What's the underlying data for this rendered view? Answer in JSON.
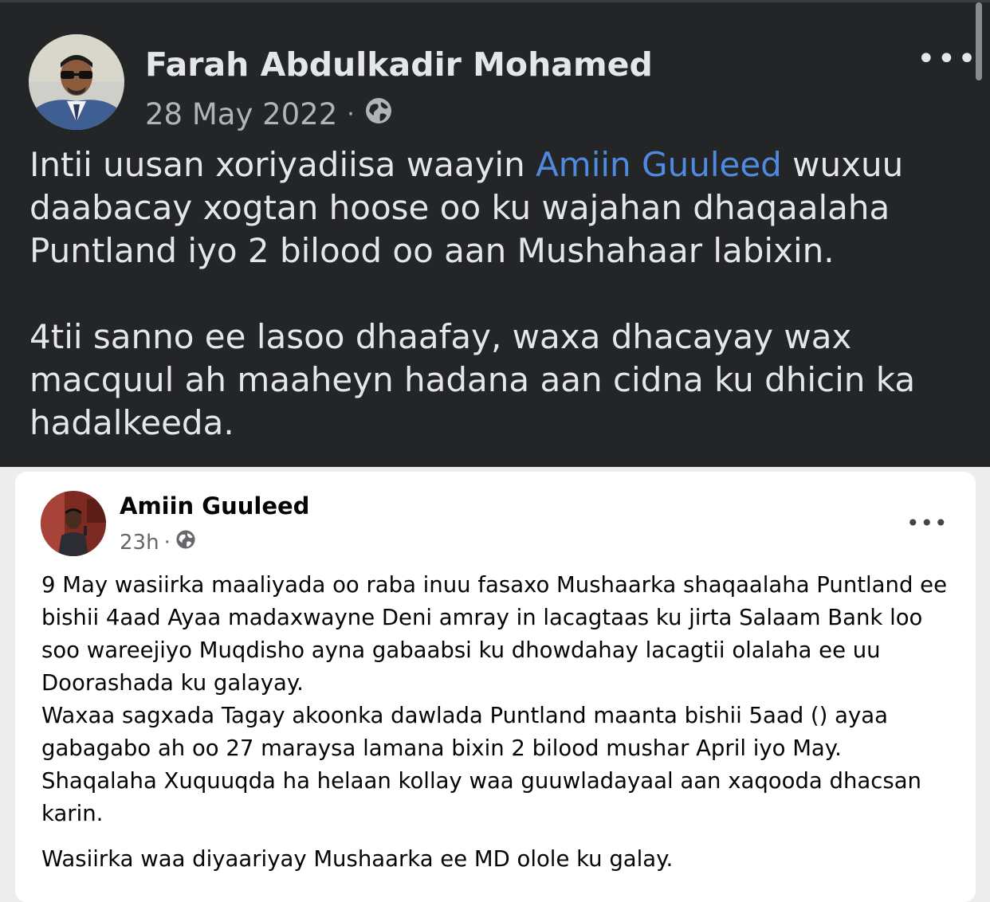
{
  "post": {
    "author": "Farah Abdulkadir Mohamed",
    "date": "28 May 2022",
    "separator": "·",
    "privacy_icon": "globe-icon",
    "menu_icon": "more-options-icon",
    "menu_label": "•••",
    "text": {
      "p1_before": "Intii uusan xoriyadiisa waayin ",
      "p1_mention": "Amiin Guuleed",
      "p1_after": " wuxuu daabacay xogtan hoose oo ku wajahan dhaqaalaha Puntland iyo 2 bilood oo aan Mushahaar labixin.",
      "p2": "4tii sanno ee lasoo dhaafay, waxa dhacayay wax macquul ah maaheyn hadana aan cidna ku dhicin ka hadalkeeda."
    }
  },
  "shared_post": {
    "author": "Amiin Guuleed",
    "time": "23h",
    "separator": "·",
    "privacy_icon": "globe-icon",
    "menu_label": "•••",
    "paragraphs": [
      "9 May wasiirka maaliyada oo raba inuu fasaxo Mushaarka shaqaalaha Puntland ee bishii 4aad Ayaa madaxwayne Deni amray in lacagtaas ku jirta Salaam Bank loo soo wareejiyo Muqdisho ayna gabaabsi ku dhowdahay lacagtii olalaha ee uu Doorashada ku galayay.",
      "Waxaa sagxada Tagay akoonka dawlada Puntland maanta bishii 5aad () ayaa gabagabo ah oo 27 maraysa lamana bixin 2 bilood mushar April iyo May.",
      "Shaqalaha Xuquuqda ha helaan kollay waa guuwladayaal aan xaqooda dhacsan karin.",
      "Wasiirka waa diyaariyay Mushaarka ee MD olole ku galay."
    ]
  },
  "colors": {
    "dark_bg": "#242526",
    "text_primary": "#e4e6eb",
    "text_secondary": "#b0b3b8",
    "mention": "#4e8ae0",
    "card_bg": "#ffffff"
  }
}
